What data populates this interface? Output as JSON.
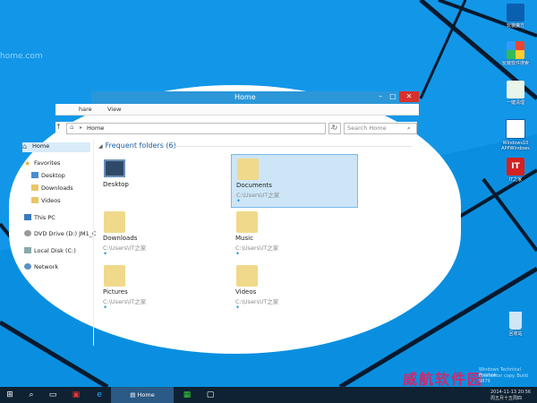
{
  "desktop": {
    "url_fragment": "home.com",
    "icons": [
      {
        "label": "玩装魔方"
      },
      {
        "label": "玩装软件搜索"
      },
      {
        "label": "一键清理"
      },
      {
        "label": "Windows10\nAPPWindows"
      },
      {
        "label": "IT之家"
      },
      {
        "label": "回收站"
      }
    ]
  },
  "window": {
    "title": "Home",
    "ribbon_tabs": [
      "hare",
      "View"
    ],
    "address": {
      "path": "Home",
      "search_placeholder": "Search Home"
    },
    "nav": {
      "home": "Home",
      "favorites": "Favorites",
      "desktop": "Desktop",
      "downloads": "Downloads",
      "videos": "Videos",
      "this_pc": "This PC",
      "dvd": "DVD Drive (D:) JM1_C",
      "local_disk": "Local Disk (C:)",
      "network": "Network"
    },
    "section": "Frequent folders (6)",
    "folders": [
      {
        "name": "Desktop",
        "path": ""
      },
      {
        "name": "Documents",
        "path": "C:\\Users\\IT之家"
      },
      {
        "name": "Downloads",
        "path": "C:\\Users\\IT之家"
      },
      {
        "name": "Music",
        "path": "C:\\Users\\IT之家"
      },
      {
        "name": "Pictures",
        "path": "C:\\Users\\IT之家"
      },
      {
        "name": "Videos",
        "path": "C:\\Users\\IT之家"
      }
    ]
  },
  "taskbar": {
    "home_label": "Home",
    "brand": "威航软件园",
    "watermark1": "Windows Technical Preview",
    "watermark2": "Evaluation copy. Build 9879",
    "time": "2014-11-13 20:56",
    "date": "周五月十五周四"
  },
  "colors": {
    "accent": "#2b97d8",
    "close": "#d9302b",
    "taskbar": "#0f2233",
    "wallpaper": "#0a8fe0"
  }
}
